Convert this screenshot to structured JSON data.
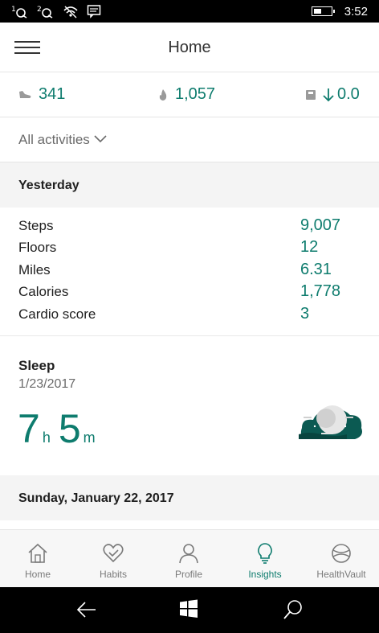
{
  "status_bar": {
    "time": "3:52",
    "battery_level": 0.45
  },
  "header": {
    "title": "Home"
  },
  "summary": {
    "steps": "341",
    "calories": "1,057",
    "weight_change": "0.0"
  },
  "filter": {
    "label": "All activities"
  },
  "yesterday": {
    "heading": "Yesterday",
    "metrics": [
      {
        "label": "Steps",
        "value": "9,007"
      },
      {
        "label": "Floors",
        "value": "12"
      },
      {
        "label": "Miles",
        "value": "6.31"
      },
      {
        "label": "Calories",
        "value": "1,778"
      },
      {
        "label": "Cardio score",
        "value": "3"
      }
    ]
  },
  "sleep": {
    "title": "Sleep",
    "date": "1/23/2017",
    "hours": "7",
    "hours_unit": "h",
    "minutes": "5",
    "minutes_unit": "m"
  },
  "next_section": {
    "heading": "Sunday, January 22, 2017"
  },
  "nav": {
    "items": [
      {
        "label": "Home",
        "icon": "home-icon"
      },
      {
        "label": "Habits",
        "icon": "heart-icon"
      },
      {
        "label": "Profile",
        "icon": "person-icon"
      },
      {
        "label": "Insights",
        "icon": "lightbulb-icon",
        "active": true
      },
      {
        "label": "HealthVault",
        "icon": "healthvault-icon"
      }
    ]
  },
  "colors": {
    "accent": "#0e7c6e",
    "text": "#1f1f1f",
    "muted": "#6a6a6a",
    "section_bg": "#f4f4f4"
  }
}
